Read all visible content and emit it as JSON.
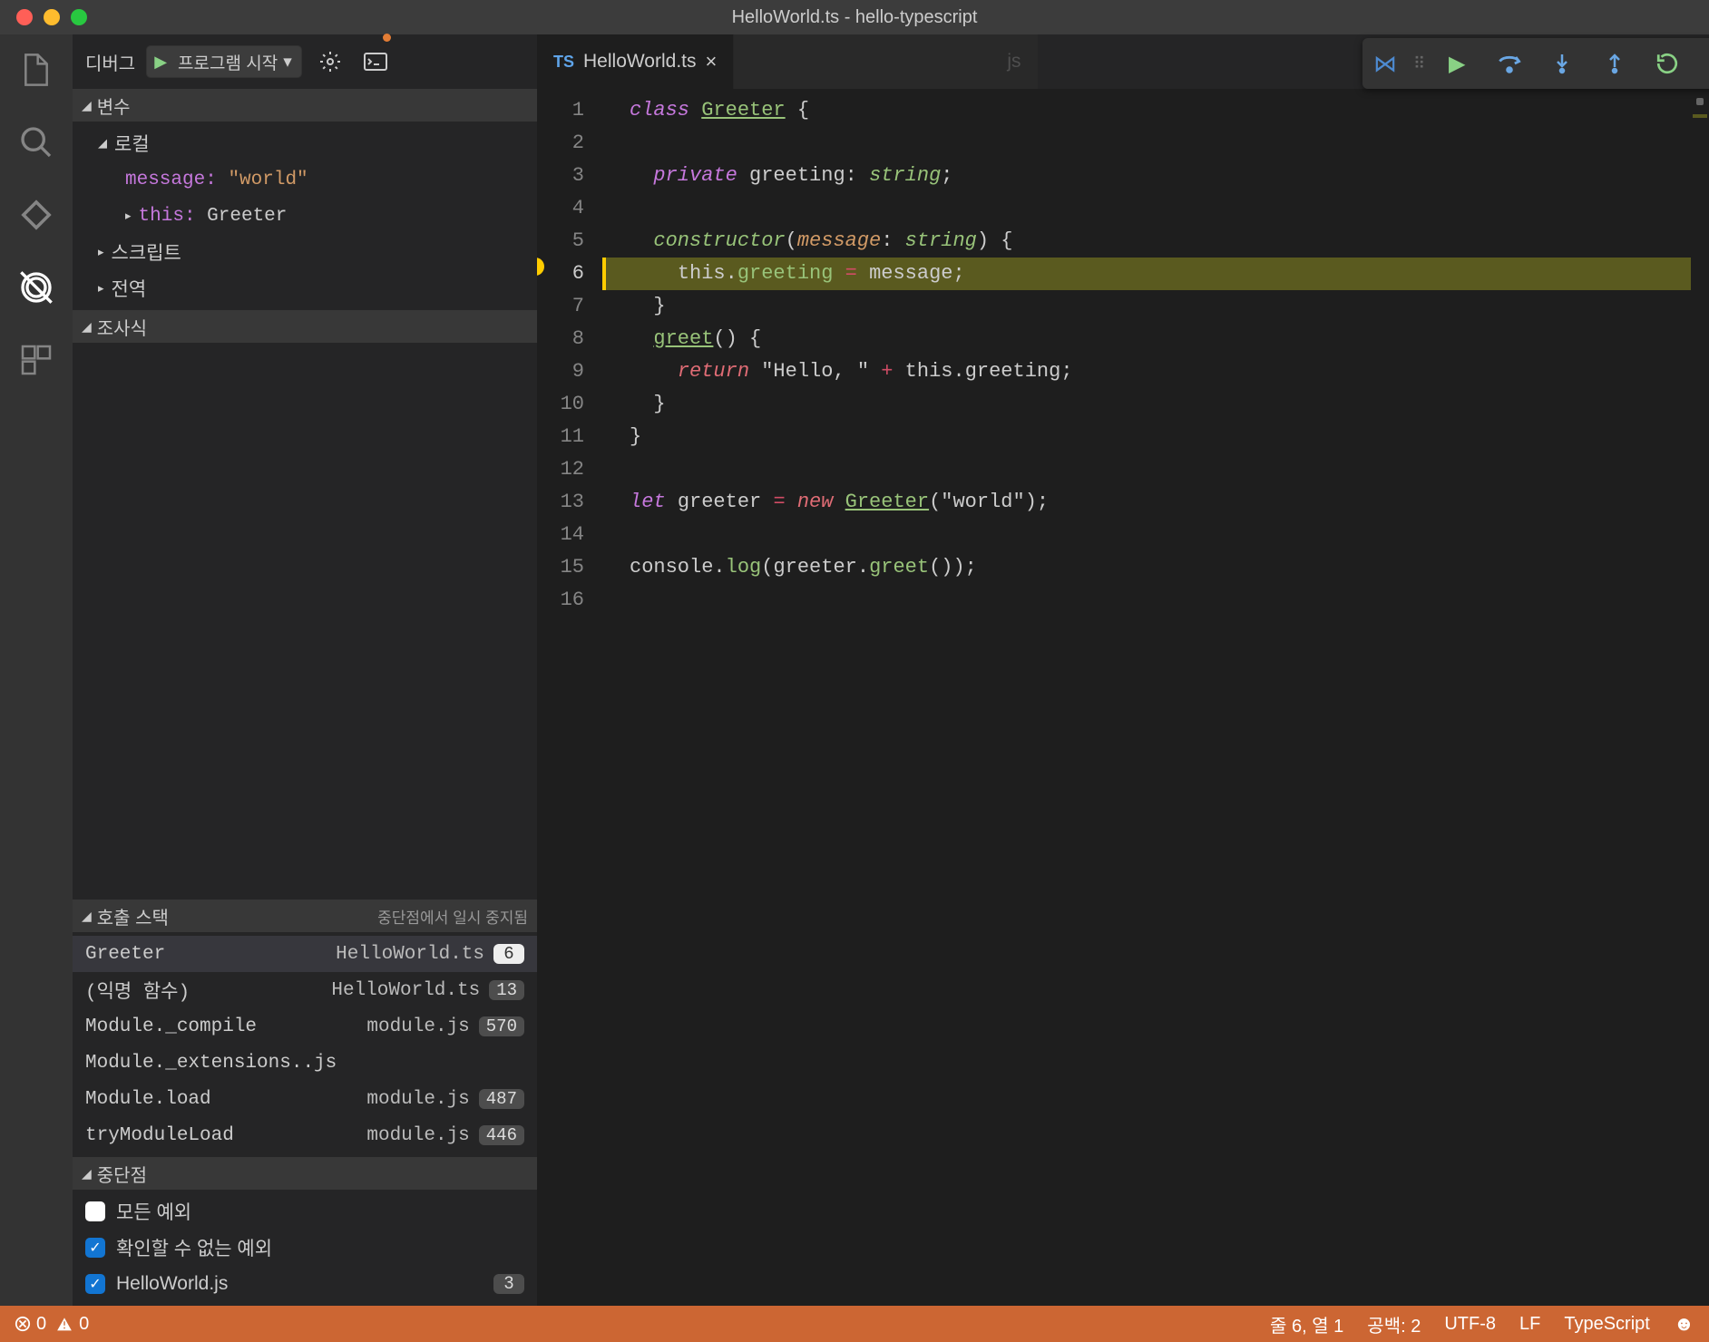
{
  "window": {
    "title": "HelloWorld.ts - hello-typescript"
  },
  "sidebar": {
    "header": {
      "label": "디버그",
      "config": "프로그램 시작"
    },
    "sections": {
      "variables": {
        "title": "변수",
        "local": "로컬",
        "rows": [
          {
            "key": "message:",
            "val": "\"world\""
          },
          {
            "key": "this:",
            "val": "Greeter"
          }
        ],
        "scripts": "스크립트",
        "global": "전역"
      },
      "watch": {
        "title": "조사식"
      },
      "callstack": {
        "title": "호출 스택",
        "status": "중단점에서 일시 중지됨",
        "rows": [
          {
            "fn": "Greeter",
            "file": "HelloWorld.ts",
            "line": "6",
            "selected": true
          },
          {
            "fn": "(익명 함수)",
            "file": "HelloWorld.ts",
            "line": "13"
          },
          {
            "fn": "Module._compile",
            "file": "module.js",
            "line": "570"
          },
          {
            "fn": "Module._extensions..js",
            "file": "",
            "line": ""
          },
          {
            "fn": "Module.load",
            "file": "module.js",
            "line": "487"
          },
          {
            "fn": "tryModuleLoad",
            "file": "module.js",
            "line": "446"
          }
        ]
      },
      "breakpoints": {
        "title": "중단점",
        "rows": [
          {
            "label": "모든 예외",
            "checked": false
          },
          {
            "label": "확인할 수 없는 예외",
            "checked": true
          },
          {
            "label": "HelloWorld.js",
            "checked": true,
            "count": "3"
          }
        ]
      }
    }
  },
  "editor": {
    "tab": {
      "badge": "TS",
      "name": "HelloWorld.ts"
    },
    "hidden_tab_suffix": "js",
    "current_line": 6,
    "lines": 16
  },
  "statusbar": {
    "errors": "0",
    "warnings": "0",
    "lncol": "줄 6, 열 1",
    "spaces": "공백: 2",
    "encoding": "UTF-8",
    "eol": "LF",
    "lang": "TypeScript"
  }
}
